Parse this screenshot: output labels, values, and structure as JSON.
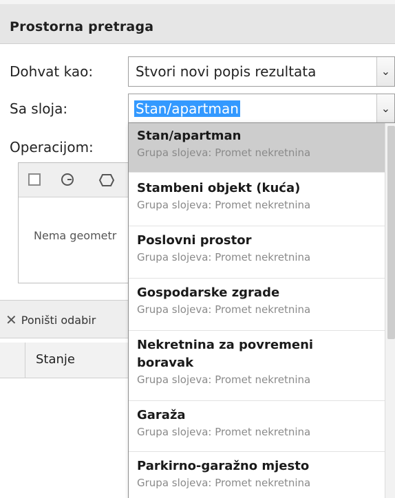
{
  "panel": {
    "title": "Prostorna pretraga"
  },
  "form": {
    "fetch_label": "Dohvat kao:",
    "fetch_value": "Stvori novi popis rezultata",
    "layer_label": "Sa sloja:",
    "layer_value": "Stan/apartman",
    "operation_label": "Operacijom:"
  },
  "geometry": {
    "tools": [
      "checkbox-icon",
      "circle-icon",
      "polygon-icon"
    ],
    "empty_text": "Nema geometr"
  },
  "toolbar": {
    "reset_label": "Poništi odabir"
  },
  "grid": {
    "columns": [
      "Stanje"
    ]
  },
  "dropdown": {
    "items": [
      {
        "name": "Stan/apartman",
        "group": "Grupa slojeva: Promet nekretnina"
      },
      {
        "name": "Stambeni objekt (kuća)",
        "group": "Grupa slojeva: Promet nekretnina"
      },
      {
        "name": "Poslovni prostor",
        "group": "Grupa slojeva: Promet nekretnina"
      },
      {
        "name": "Gospodarske zgrade",
        "group": "Grupa slojeva: Promet nekretnina"
      },
      {
        "name": "Nekretnina za povremeni boravak",
        "group": "Grupa slojeva: Promet nekretnina"
      },
      {
        "name": "Garaža",
        "group": "Grupa slojeva: Promet nekretnina"
      },
      {
        "name": "Parkirno-garažno mjesto",
        "group": "Grupa slojeva: Promet nekretnina"
      }
    ]
  }
}
